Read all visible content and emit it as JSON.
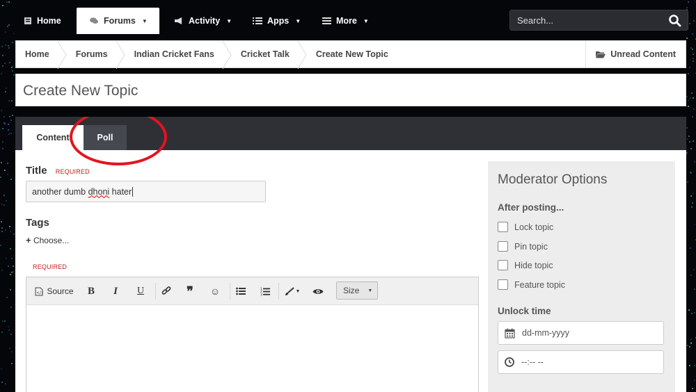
{
  "nav": {
    "items": [
      {
        "label": "Home",
        "icon": "home-icon"
      },
      {
        "label": "Forums",
        "icon": "chat-icon",
        "active": true
      },
      {
        "label": "Activity",
        "icon": "megaphone-icon"
      },
      {
        "label": "Apps",
        "icon": "list-icon"
      },
      {
        "label": "More",
        "icon": "menu-icon"
      }
    ],
    "search_placeholder": "Search..."
  },
  "breadcrumb": {
    "items": [
      "Home",
      "Forums",
      "Indian Cricket Fans",
      "Cricket Talk",
      "Create New Topic"
    ],
    "unread_label": "Unread Content"
  },
  "page_title": "Create New Topic",
  "tabs": {
    "content": "Content",
    "poll": "Poll"
  },
  "form": {
    "title_label": "Title",
    "required_label": "REQUIRED",
    "title_value_prefix": "another dumb ",
    "title_value_misspelled": "dhoni",
    "title_value_suffix": " hater",
    "tags_label": "Tags",
    "choose_label": "Choose...",
    "editor_required_label": "REQUIRED"
  },
  "editor": {
    "source_label": "Source",
    "bold": "B",
    "italic": "I",
    "underline": "U",
    "size_label": "Size"
  },
  "moderator": {
    "title": "Moderator Options",
    "after_posting_label": "After posting...",
    "options": [
      "Lock topic",
      "Pin topic",
      "Hide topic",
      "Feature topic"
    ],
    "unlock_label": "Unlock time",
    "date_placeholder": "dd-mm-yyyy",
    "time_placeholder": "--:-- --"
  },
  "colors": {
    "annotation_circle": "#e3141e",
    "required": "#c41c1c",
    "tabbar": "#2e3036"
  }
}
